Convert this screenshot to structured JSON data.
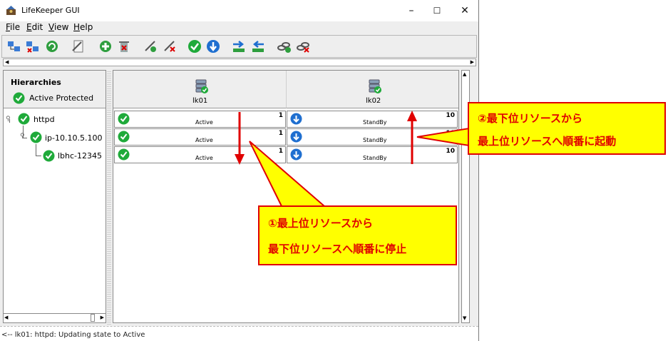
{
  "window": {
    "title": "LifeKeeper GUI",
    "controls": {
      "minimize": "–",
      "maximize": "☐",
      "close": "✕"
    }
  },
  "menubar": {
    "items": [
      {
        "mnemonic": "F",
        "rest": "ile"
      },
      {
        "mnemonic": "E",
        "rest": "dit"
      },
      {
        "mnemonic": "V",
        "rest": "iew"
      },
      {
        "mnemonic": "H",
        "rest": "elp"
      }
    ]
  },
  "toolbar": {
    "buttons": [
      "connect-servers-icon",
      "disconnect-servers-icon",
      "refresh-icon",
      "properties-icon",
      "create-resource-icon",
      "delete-resource-icon",
      "extend-resource-icon",
      "unextend-resource-icon",
      "in-service-icon",
      "out-of-service-icon",
      "switchover-icon",
      "switchback-icon",
      "create-dependency-icon",
      "delete-dependency-icon"
    ]
  },
  "hierarchies": {
    "title": "Hierarchies",
    "status": "Active Protected",
    "tree": [
      {
        "label": "httpd"
      },
      {
        "label": "ip-10.10.5.100"
      },
      {
        "label": "lbhc-12345"
      }
    ]
  },
  "servers": [
    {
      "name": "lk01",
      "cells": [
        {
          "state": "Active",
          "priority": "1"
        },
        {
          "state": "Active",
          "priority": "1"
        },
        {
          "state": "Active",
          "priority": "1"
        }
      ]
    },
    {
      "name": "lk02",
      "cells": [
        {
          "state": "StandBy",
          "priority": "10"
        },
        {
          "state": "StandBy",
          "priority": "10"
        },
        {
          "state": "StandBy",
          "priority": "10"
        }
      ]
    }
  ],
  "status_bar": {
    "text": "<-- lk01: httpd: Updating state to Active"
  },
  "annotations": {
    "callout_right": {
      "line1": "②最下位リソースから",
      "line2": "最上位リソースへ順番に起動"
    },
    "callout_bottom": {
      "line1": "①最上位リソースから",
      "line2": "最下位リソースへ順番に停止"
    }
  },
  "colors": {
    "active_green": "#1faa3a",
    "standby_blue": "#1f6fd0",
    "callout_fill": "#ffff00",
    "callout_red": "#e00000"
  }
}
